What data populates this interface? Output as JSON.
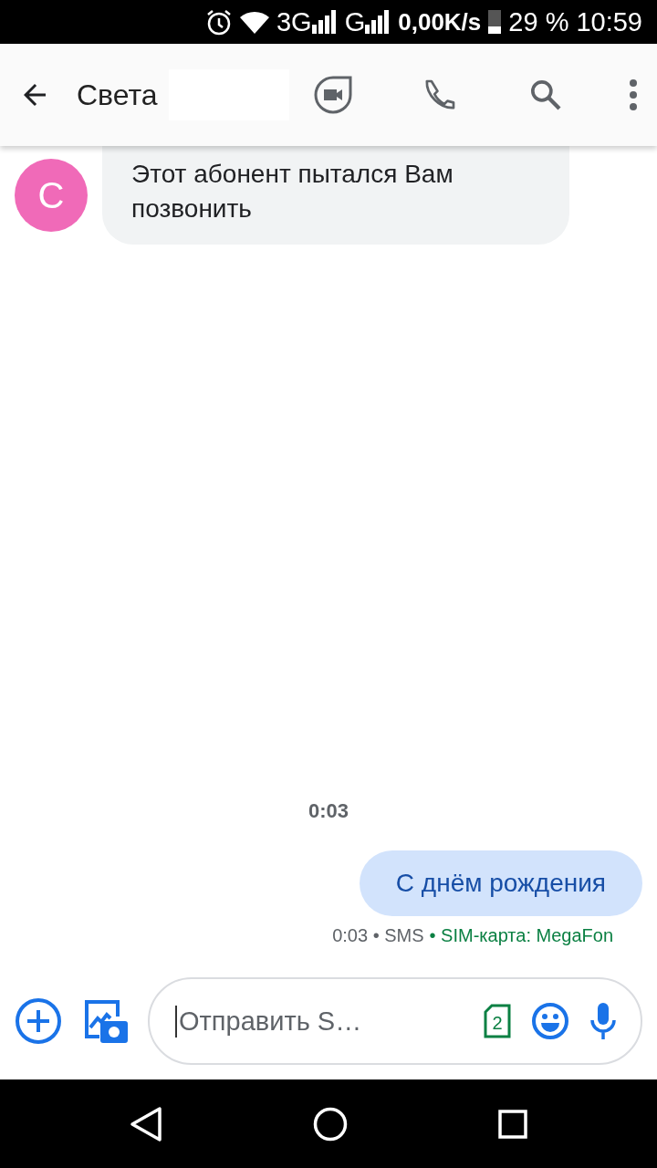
{
  "status_bar": {
    "network_1": "3G",
    "network_2": "G",
    "speed": "0,00K/s",
    "battery": "29 %",
    "time": "10:59"
  },
  "header": {
    "title": "Света"
  },
  "messages": [
    {
      "kind": "incoming",
      "avatar_letter": "С",
      "color": "#f06ab8",
      "text": "Этот абонент пытался Вам позвонить"
    },
    {
      "kind": "timestamp",
      "text": "0:03"
    },
    {
      "kind": "outgoing",
      "text": "С днём рождения",
      "meta": "0:03 • SMS",
      "sim": "• SIM-карта: MegaFon"
    }
  ],
  "composer": {
    "placeholder": "Отправить S…",
    "sim_number": "2"
  }
}
